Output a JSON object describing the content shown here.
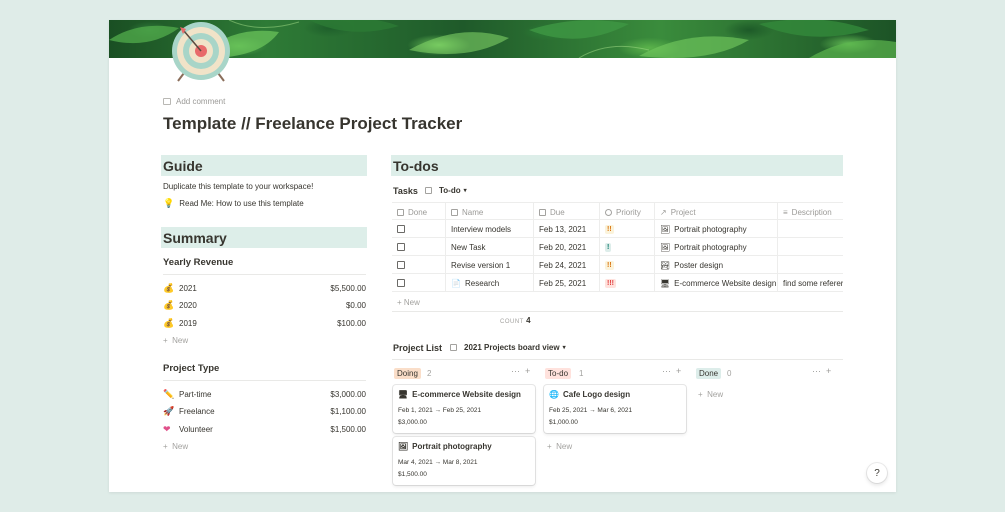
{
  "add_comment": "Add comment",
  "title": "Template // Freelance Project Tracker",
  "guide": {
    "heading": "Guide",
    "text": "Duplicate this template to your workspace!",
    "link": "Read Me: How to use this template"
  },
  "summary": {
    "heading": "Summary",
    "yearly_title": "Yearly Revenue",
    "yearly": [
      {
        "label": "2021",
        "value": "$5,500.00"
      },
      {
        "label": "2020",
        "value": "$0.00"
      },
      {
        "label": "2019",
        "value": "$100.00"
      }
    ],
    "new": "New",
    "type_title": "Project Type",
    "types": [
      {
        "label": "Part-time",
        "value": "$3,000.00"
      },
      {
        "label": "Freelance",
        "value": "$1,100.00"
      },
      {
        "label": "Volunteer",
        "value": "$1,500.00"
      }
    ]
  },
  "todos": {
    "heading": "To-dos",
    "tasks_label": "Tasks",
    "view": "To-do",
    "columns": [
      "Done",
      "Name",
      "Due",
      "Priority",
      "Project",
      "Description"
    ],
    "rows": [
      {
        "name": "Interview models",
        "due": "Feb 13, 2021",
        "priority": "!!",
        "project": "Portrait photography",
        "description": ""
      },
      {
        "name": "New Task",
        "due": "Feb 20, 2021",
        "priority": "!",
        "project": "Portrait photography",
        "description": ""
      },
      {
        "name": "Revise version 1",
        "due": "Feb 24, 2021",
        "priority": "!!",
        "project": "Poster design",
        "description": ""
      },
      {
        "name": "Research",
        "due": "Feb 25, 2021",
        "priority": "!!!",
        "project": "E-commerce Website design",
        "description": "find some referer"
      }
    ],
    "new": "New",
    "count_label": "COUNT",
    "count": "4"
  },
  "project_list": {
    "label": "Project List",
    "view": "2021 Projects board view",
    "groups": [
      {
        "status": "Doing",
        "count": "2"
      },
      {
        "status": "To-do",
        "count": "1"
      },
      {
        "status": "Done",
        "count": "0"
      }
    ],
    "cards": [
      {
        "title": "E-commerce Website design",
        "dates": "Feb 1, 2021 → Feb 25, 2021",
        "amount": "$3,000.00"
      },
      {
        "title": "Portrait photography",
        "dates": "Mar 4, 2021 → Mar 8, 2021",
        "amount": "$1,500.00"
      },
      {
        "title": "Cafe Logo design",
        "dates": "Feb 25, 2021 → Mar 6, 2021",
        "amount": "$1,000.00"
      }
    ],
    "new": "New"
  },
  "help": "?"
}
